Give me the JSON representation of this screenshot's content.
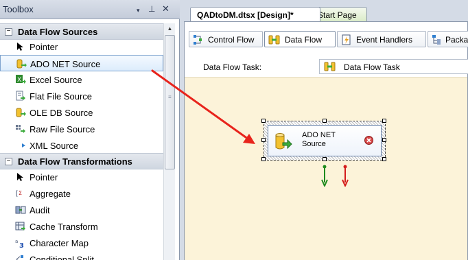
{
  "toolbox": {
    "title": "Toolbox",
    "header_buttons": {
      "dropdown": "▾",
      "pin": "⊥",
      "close": "✕"
    },
    "sections": [
      {
        "label": "Data Flow Sources",
        "expanded_glyph": "−",
        "items": [
          {
            "label": "Pointer",
            "icon": "pointer-icon",
            "selected": false
          },
          {
            "label": "ADO NET Source",
            "icon": "ado-net-source-icon",
            "selected": true
          },
          {
            "label": "Excel Source",
            "icon": "excel-source-icon",
            "selected": false
          },
          {
            "label": "Flat File Source",
            "icon": "flat-file-source-icon",
            "selected": false
          },
          {
            "label": "OLE DB Source",
            "icon": "ole-db-source-icon",
            "selected": false
          },
          {
            "label": "Raw File Source",
            "icon": "raw-file-source-icon",
            "selected": false
          },
          {
            "label": "XML Source",
            "icon": "xml-source-icon",
            "selected": false
          }
        ]
      },
      {
        "label": "Data Flow Transformations",
        "expanded_glyph": "−",
        "items": [
          {
            "label": "Pointer",
            "icon": "pointer-icon",
            "selected": false
          },
          {
            "label": "Aggregate",
            "icon": "aggregate-icon",
            "selected": false
          },
          {
            "label": "Audit",
            "icon": "audit-icon",
            "selected": false
          },
          {
            "label": "Cache Transform",
            "icon": "cache-transform-icon",
            "selected": false
          },
          {
            "label": "Character Map",
            "icon": "character-map-icon",
            "selected": false
          },
          {
            "label": "Conditional Split",
            "icon": "conditional-split-icon",
            "selected": false
          }
        ]
      }
    ]
  },
  "document": {
    "tabs": [
      {
        "label": "QADtoDM.dtsx [Design]*",
        "active": true
      },
      {
        "label": "Start Page",
        "active": false
      }
    ],
    "designer_tabs": [
      {
        "label": "Control Flow",
        "icon": "control-flow-icon",
        "active": false
      },
      {
        "label": "Data Flow",
        "icon": "data-flow-icon",
        "active": true
      },
      {
        "label": "Event Handlers",
        "icon": "event-handlers-icon",
        "active": false
      },
      {
        "label": "Packa",
        "icon": "package-explorer-icon",
        "active": false
      }
    ],
    "task_label": "Data Flow Task:",
    "task_selected": "Data Flow Task"
  },
  "canvas": {
    "component": {
      "label": "ADO NET\nSource",
      "icon": "ado-net-source-icon",
      "status_icon": "error-icon"
    }
  },
  "colors": {
    "canvas_bg": "#fcf3d9",
    "drag_arrow": "#e8241c",
    "success_path": "#1e8a1e",
    "error_path": "#d31b1b",
    "selected_item_border": "#7da2ce"
  }
}
